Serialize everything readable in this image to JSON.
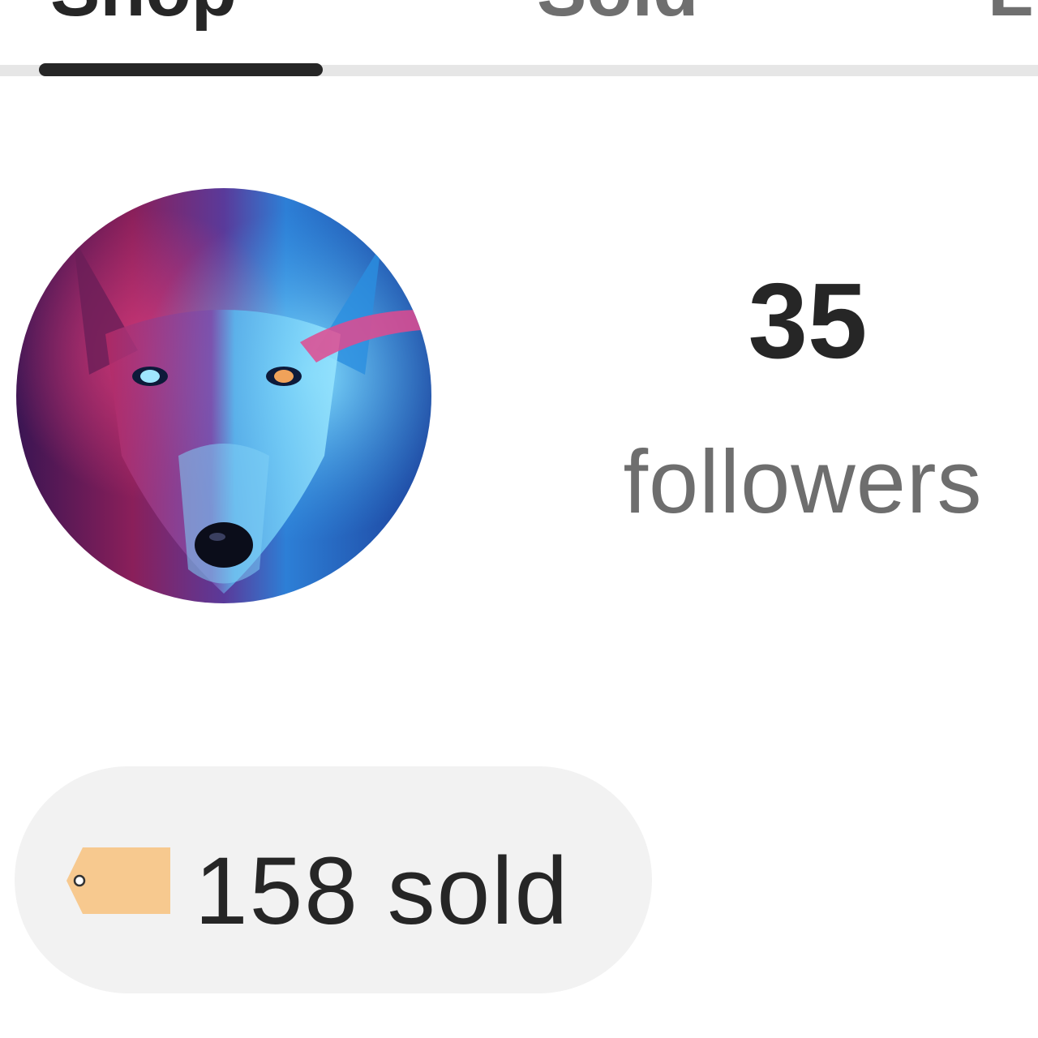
{
  "tabs": [
    {
      "label": "Shop",
      "active": true
    },
    {
      "label": "Sold",
      "active": false
    },
    {
      "label": "Likes",
      "active": false
    }
  ],
  "profile": {
    "avatar_icon": "wolf-avatar-image",
    "followers_count": "35",
    "followers_label": "followers",
    "sold_label": "158 sold",
    "sold_icon": "price-tag-icon"
  },
  "colors": {
    "text_primary": "#262626",
    "text_secondary": "#6e6e6e",
    "pill_background": "#f2f2f2",
    "tag": "#f7c98f"
  }
}
